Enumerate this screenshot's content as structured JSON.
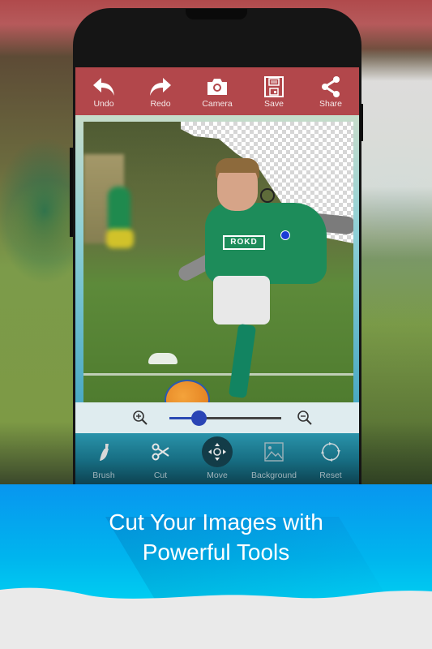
{
  "toolbar": {
    "items": [
      {
        "label": "Undo",
        "icon": "undo-arrow-icon"
      },
      {
        "label": "Redo",
        "icon": "redo-arrow-icon"
      },
      {
        "label": "Camera",
        "icon": "camera-icon"
      },
      {
        "label": "Save",
        "icon": "floppy-disk-icon"
      },
      {
        "label": "Share",
        "icon": "share-icon"
      }
    ],
    "color": "#b2474b"
  },
  "canvas": {
    "sponsor_text": "ROKD",
    "collapse_glyph": "»"
  },
  "zoom": {
    "zoom_in_icon": "zoom-in-icon",
    "zoom_out_icon": "zoom-out-icon",
    "slider_value_percent": 26
  },
  "bottom_tools": {
    "items": [
      {
        "label": "Brush",
        "icon": "brush-icon",
        "active": false
      },
      {
        "label": "Cut",
        "icon": "scissors-icon",
        "active": false
      },
      {
        "label": "Move",
        "icon": "move-icon",
        "active": true
      },
      {
        "label": "Background",
        "icon": "image-icon",
        "active": false
      },
      {
        "label": "Reset",
        "icon": "reset-icon",
        "active": false
      }
    ]
  },
  "banner": {
    "line1": "Cut Your Images with",
    "line2": "Powerful Tools",
    "color": "#00b5ee"
  }
}
